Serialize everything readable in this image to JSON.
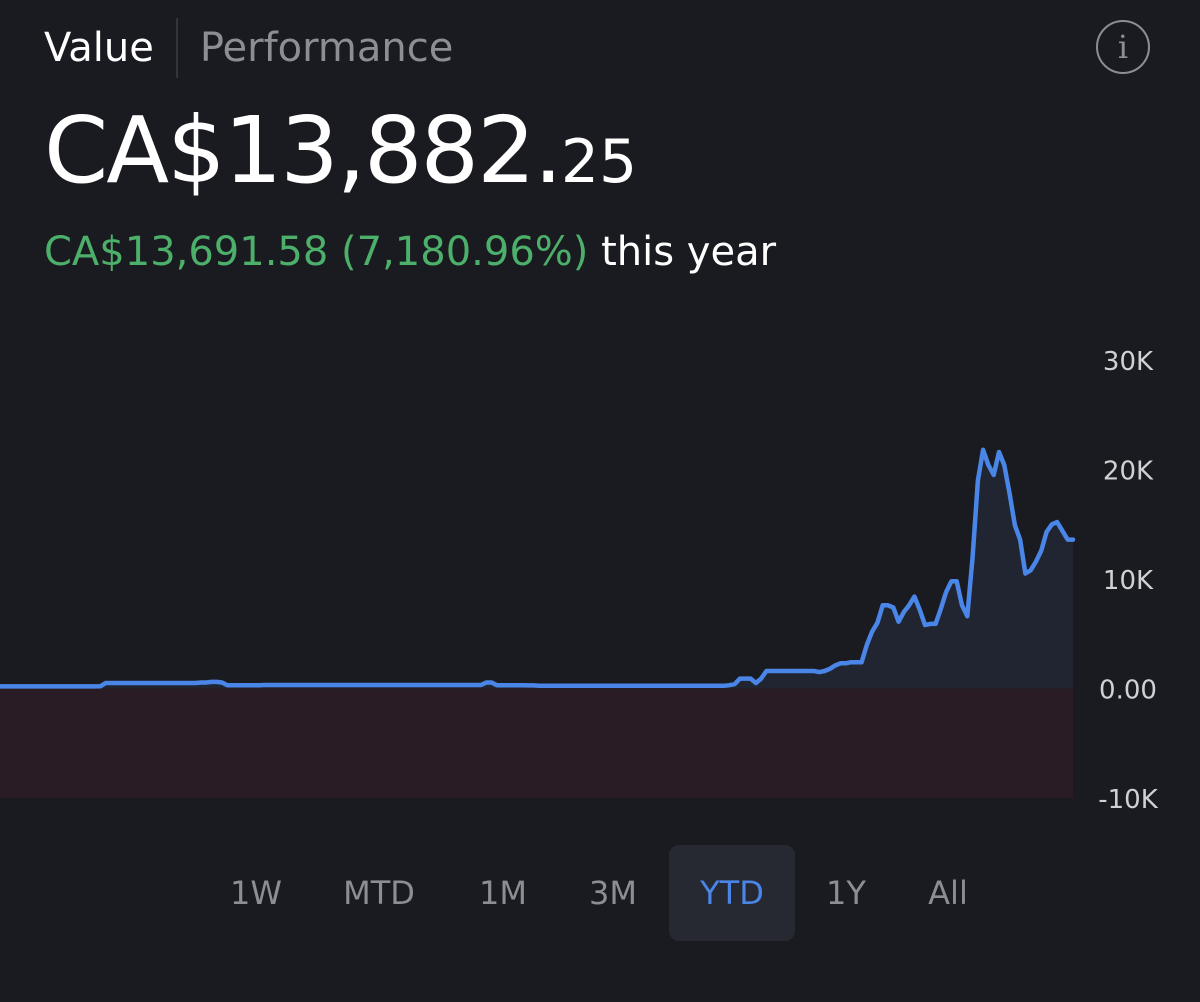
{
  "tabs": [
    {
      "label": "Value",
      "active": true
    },
    {
      "label": "Performance",
      "active": false
    }
  ],
  "info_icon": "info-icon",
  "portfolio": {
    "value_main": "CA$13,882.",
    "value_cents": "25",
    "change_amount": "CA$13,691.58 (7,180.96%)",
    "change_suffix": "this year"
  },
  "colors": {
    "background": "#1a1b20",
    "positive": "#4caf6a",
    "line": "#4a86e8",
    "negative_zone": "#2a1c24",
    "muted_text": "#8d8e93"
  },
  "periods": [
    {
      "label": "1W",
      "selected": false
    },
    {
      "label": "MTD",
      "selected": false
    },
    {
      "label": "1M",
      "selected": false
    },
    {
      "label": "3M",
      "selected": false
    },
    {
      "label": "YTD",
      "selected": true
    },
    {
      "label": "1Y",
      "selected": false
    },
    {
      "label": "All",
      "selected": false
    }
  ],
  "chart_data": {
    "type": "area",
    "title": "",
    "xlabel": "",
    "ylabel": "",
    "ylim": [
      -10000,
      30000
    ],
    "y_ticks": [
      {
        "value": 30000,
        "label": "30K"
      },
      {
        "value": 20000,
        "label": "20K"
      },
      {
        "value": 10000,
        "label": "10K"
      },
      {
        "value": 0,
        "label": "0.00"
      },
      {
        "value": -10000,
        "label": "-10K"
      }
    ],
    "grid": false,
    "negative_region_shaded": true,
    "series": [
      {
        "values": [
          190,
          190,
          190,
          190,
          190,
          190,
          190,
          190,
          190,
          190,
          190,
          190,
          190,
          190,
          190,
          190,
          190,
          190,
          190,
          200,
          500,
          500,
          500,
          500,
          500,
          500,
          500,
          500,
          500,
          500,
          500,
          500,
          500,
          500,
          500,
          500,
          500,
          500,
          550,
          550,
          600,
          600,
          550,
          300,
          300,
          300,
          300,
          300,
          300,
          300,
          320,
          320,
          320,
          320,
          320,
          320,
          320,
          320,
          320,
          320,
          320,
          320,
          320,
          320,
          320,
          320,
          320,
          320,
          320,
          320,
          320,
          320,
          320,
          320,
          320,
          320,
          320,
          320,
          320,
          320,
          320,
          320,
          320,
          320,
          320,
          320,
          320,
          320,
          320,
          320,
          320,
          320,
          550,
          550,
          300,
          300,
          300,
          300,
          300,
          300,
          280,
          280,
          250,
          250,
          250,
          250,
          250,
          250,
          250,
          250,
          250,
          250,
          250,
          250,
          250,
          250,
          250,
          250,
          250,
          250,
          250,
          250,
          250,
          250,
          250,
          250,
          250,
          250,
          250,
          250,
          250,
          250,
          250,
          250,
          250,
          250,
          250,
          250,
          300,
          400,
          900,
          900,
          900,
          500,
          900,
          1600,
          1600,
          1600,
          1600,
          1600,
          1600,
          1600,
          1600,
          1600,
          1600,
          1500,
          1600,
          1800,
          2100,
          2300,
          2300,
          2400,
          2400,
          2400,
          4000,
          5200,
          6000,
          7600,
          7600,
          7400,
          6100,
          7000,
          7600,
          8400,
          7200,
          5800,
          5900,
          5900,
          7300,
          8800,
          9800,
          9800,
          7600,
          6600,
          12000,
          19000,
          21800,
          20400,
          19500,
          21600,
          20400,
          17800,
          14900,
          13600,
          10500,
          10800,
          11600,
          12600,
          14300,
          15000,
          15200,
          14400,
          13600,
          13600
        ]
      }
    ]
  }
}
